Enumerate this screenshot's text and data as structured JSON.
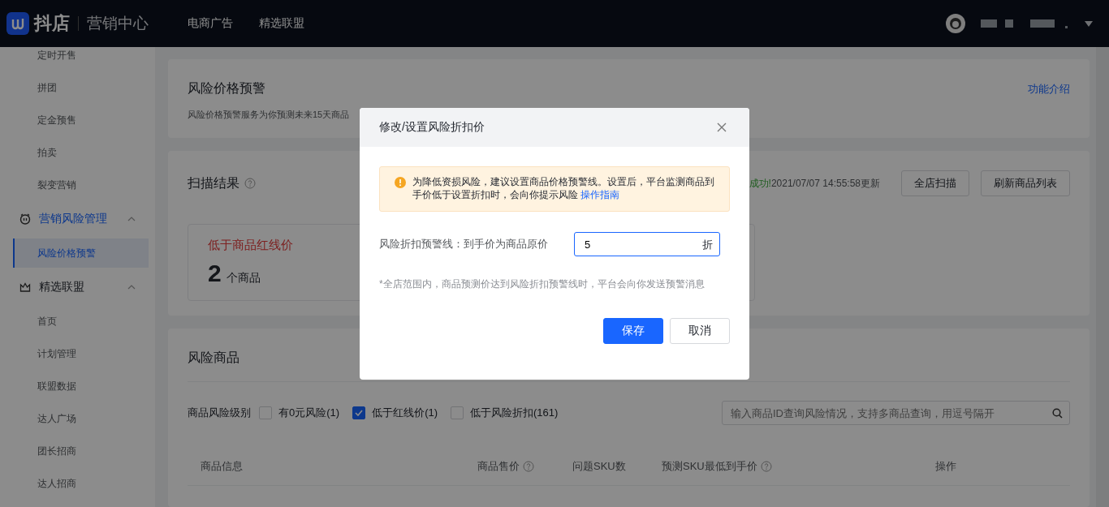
{
  "header": {
    "logo": "抖店",
    "subtitle": "营销中心",
    "nav": [
      {
        "label": "电商广告"
      },
      {
        "label": "精选联盟"
      }
    ]
  },
  "sidebar": {
    "items": [
      {
        "label": "定时开售",
        "kind": "item",
        "selected": false
      },
      {
        "label": "拼团",
        "kind": "item",
        "selected": false
      },
      {
        "label": "定金预售",
        "kind": "item",
        "selected": false
      },
      {
        "label": "拍卖",
        "kind": "item",
        "selected": false
      },
      {
        "label": "裂变营销",
        "kind": "item",
        "selected": false
      },
      {
        "label": "营销风险管理",
        "kind": "group",
        "expanded": true,
        "active": true,
        "children": [
          {
            "label": "风险价格预警",
            "selected": true
          }
        ]
      },
      {
        "label": "精选联盟",
        "kind": "group",
        "expanded": true,
        "active": false,
        "children": [
          {
            "label": "首页",
            "selected": false
          },
          {
            "label": "计划管理",
            "selected": false
          },
          {
            "label": "联盟数据",
            "selected": false
          },
          {
            "label": "达人广场",
            "selected": false
          },
          {
            "label": "团长招商",
            "selected": false
          },
          {
            "label": "达人招商",
            "selected": false
          }
        ]
      }
    ]
  },
  "intro_card": {
    "title": "风险价格预警",
    "description": "风险价格预警服务为你预测未来15天商品",
    "link": "功能介绍"
  },
  "scan_card": {
    "title": "扫描结果",
    "status": "成功!",
    "updated": "2021/07/07 14:55:58更新",
    "buttons": [
      "全店扫描",
      "刷新商品列表"
    ],
    "stats": [
      {
        "label": "低于商品红线价",
        "count": "2",
        "unit": "个商品"
      }
    ]
  },
  "products_card": {
    "title": "风险商品",
    "filter_label": "商品风险级别",
    "filters": [
      {
        "label": "有0元风险(1)",
        "checked": false
      },
      {
        "label": "低于红线价(1)",
        "checked": true
      },
      {
        "label": "低于风险折扣(161)",
        "checked": false
      }
    ],
    "search": {
      "placeholder": "输入商品ID查询风险情况，支持多商品查询，用逗号隔开"
    },
    "columns": [
      {
        "label": "商品信息",
        "help": false
      },
      {
        "label": "商品售价",
        "help": true
      },
      {
        "label": "问题SKU数",
        "help": false
      },
      {
        "label": "预测SKU最低到手价",
        "help": true
      },
      {
        "label": "操作",
        "help": false
      }
    ]
  },
  "dialog": {
    "title": "修改/设置风险折扣价",
    "alert": {
      "text": "为降低资损风险，建议设置商品价格预警线。设置后，平台监测商品到手价低于设置折扣时，会向你提示风险",
      "link": "操作指南"
    },
    "field": {
      "label": "风险折扣预警线：到手价为商品原价",
      "value": "5",
      "suffix": "折"
    },
    "note": "*全店范围内，商品预测价达到风险折扣预警线时，平台会向你发送预警消息",
    "buttons": [
      {
        "label": "保存",
        "kind": "primary"
      },
      {
        "label": "取消",
        "kind": "default"
      }
    ]
  }
}
